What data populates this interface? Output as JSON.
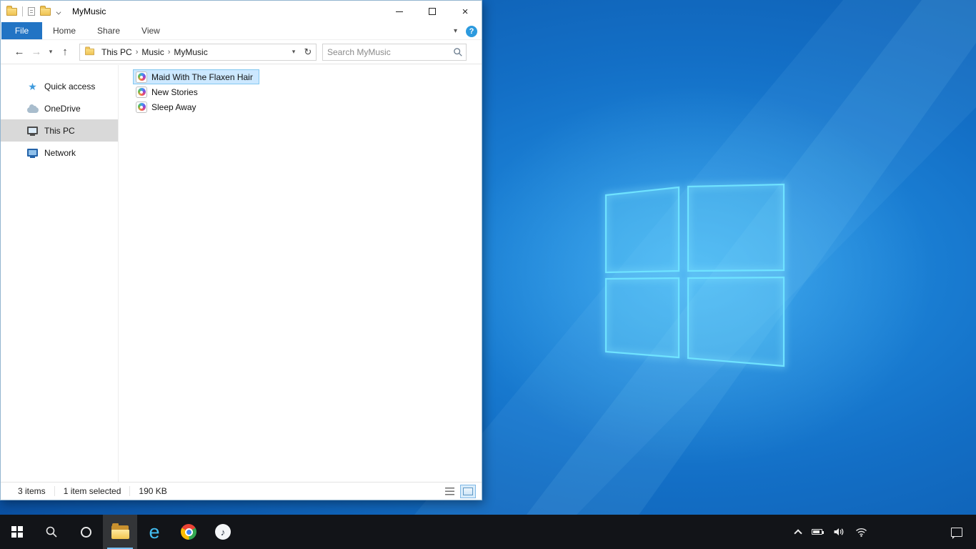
{
  "wallpaper": {
    "base_color": "#0f6cbd",
    "logo_color": "#6fe3ff"
  },
  "explorer": {
    "titlebar": {
      "title": "MyMusic"
    },
    "tabs": {
      "file": "File",
      "home": "Home",
      "share": "Share",
      "view": "View"
    },
    "ribbon": {
      "help_glyph": "?"
    },
    "address": {
      "crumbs": [
        "This PC",
        "Music",
        "MyMusic"
      ],
      "separator": "›",
      "search_placeholder": "Search MyMusic"
    },
    "sidebar": {
      "items": [
        {
          "label": "Quick access"
        },
        {
          "label": "OneDrive"
        },
        {
          "label": "This PC"
        },
        {
          "label": "Network"
        }
      ]
    },
    "files": [
      {
        "name": "Maid With The Flaxen Hair"
      },
      {
        "name": "New Stories"
      },
      {
        "name": "Sleep Away"
      }
    ],
    "status": {
      "items_count": "3 items",
      "selection": "1 item selected",
      "size": "190 KB"
    }
  },
  "icons": {
    "back": "←",
    "forward": "→",
    "up": "↑",
    "refresh": "↻",
    "chevron_down": "▾",
    "close": "×",
    "note": "♪",
    "star": "★",
    "ie": "e"
  }
}
